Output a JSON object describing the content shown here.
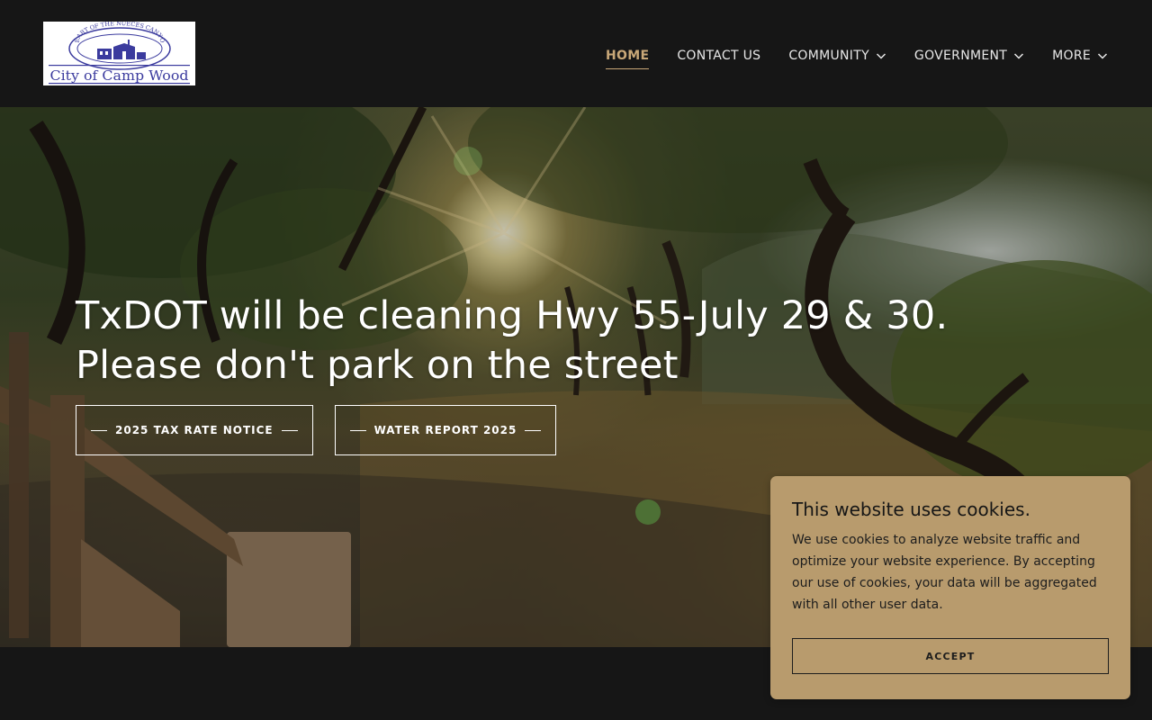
{
  "header": {
    "logo": {
      "arc_text": "HEART OF THE NUECES CANYON",
      "name_text": "City of Camp Wood"
    },
    "nav": [
      {
        "label": "HOME",
        "active": true,
        "has_dropdown": false
      },
      {
        "label": "CONTACT US",
        "active": false,
        "has_dropdown": false
      },
      {
        "label": "COMMUNITY",
        "active": false,
        "has_dropdown": true
      },
      {
        "label": "GOVERNMENT",
        "active": false,
        "has_dropdown": true
      },
      {
        "label": "MORE",
        "active": false,
        "has_dropdown": true
      }
    ],
    "icons": {
      "dropdown": "chevron-down-icon"
    }
  },
  "hero": {
    "title_line1": "TxDOT will be cleaning Hwy 55-July 29 & 30.",
    "title_line2": "Please don't park on the street",
    "buttons": [
      {
        "label": "2025 TAX RATE NOTICE"
      },
      {
        "label": "WATER REPORT 2025"
      }
    ]
  },
  "cookie_banner": {
    "title": "This website uses cookies.",
    "body": "We use cookies to analyze website traffic and optimize your website experience. By accepting our use of cookies, your data will be aggregated with all other user data.",
    "accept_label": "ACCEPT"
  },
  "colors": {
    "background": "#161616",
    "accent": "#c9a878",
    "cookie_bg": "#b89b6d",
    "logo_blue": "#3b3b9e"
  }
}
